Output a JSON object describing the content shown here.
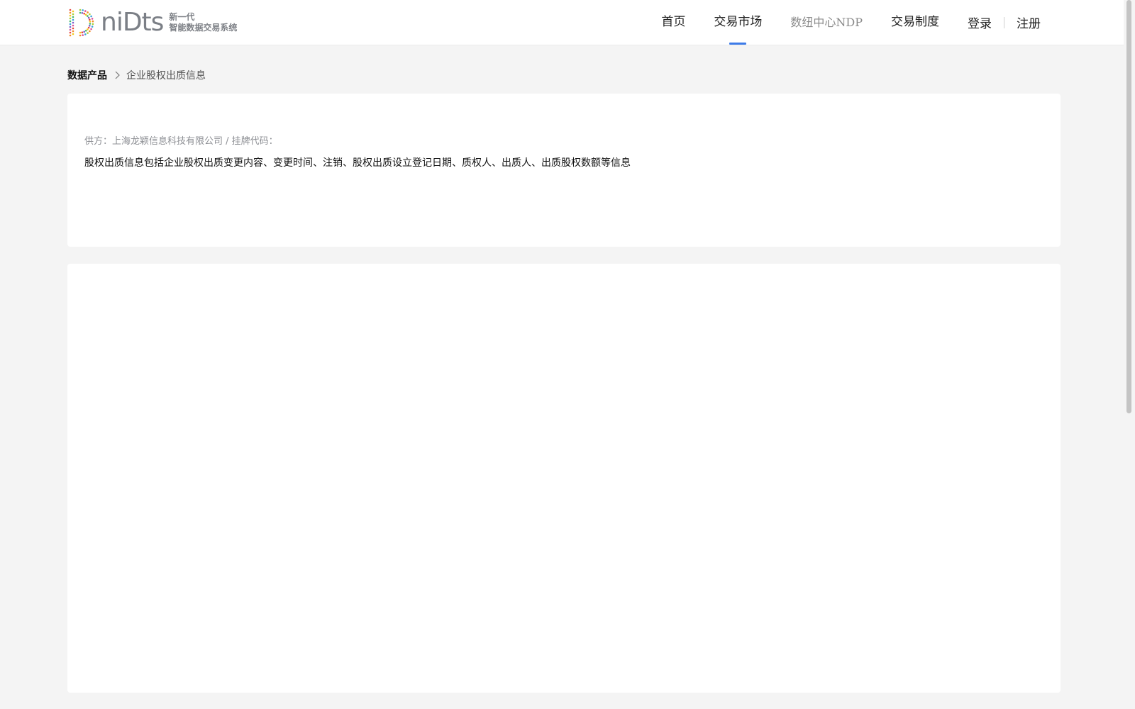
{
  "logo": {
    "word": "niDts",
    "tag_line1": "新一代",
    "tag_line2": "智能数据交易系统",
    "icon": "dotted-d-logo"
  },
  "nav": {
    "items": [
      {
        "label": "首页",
        "active": false
      },
      {
        "label": "交易市场",
        "active": true
      },
      {
        "label": "数纽中心NDP",
        "active": false
      },
      {
        "label": "交易制度",
        "active": false
      }
    ],
    "login_label": "登录",
    "register_label": "注册"
  },
  "breadcrumb": {
    "root": "数据产品",
    "current": "企业股权出质信息",
    "separator_icon": "chevron-right-icon"
  },
  "product": {
    "provider_line": "供方：上海龙颖信息科技有限公司 / 挂牌代码：",
    "description": "股权出质信息包括企业股权出质变更内容、变更时间、注销、股权出质设立登记日期、质权人、出质人、出质股权数额等信息"
  },
  "colors": {
    "accent": "#3d7be8",
    "page_bg": "#f4f4f4",
    "card_bg": "#ffffff"
  }
}
